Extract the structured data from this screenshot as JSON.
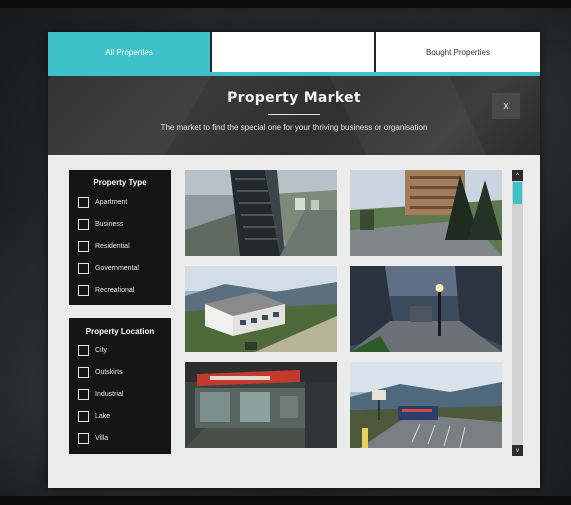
{
  "tabs": [
    {
      "label": "All Properties",
      "active": true
    },
    {
      "label": "",
      "active": false
    },
    {
      "label": "Bought Properties",
      "active": false
    }
  ],
  "header": {
    "title": "Property Market",
    "subtitle": "The market to find the special one for your thriving business or organisation",
    "close_label": "X"
  },
  "filters": {
    "property_type": {
      "title": "Property Type",
      "options": [
        "Apartment",
        "Business",
        "Residential",
        "Governmental",
        "Recreational"
      ]
    },
    "property_location": {
      "title": "Property Location",
      "options": [
        "City",
        "Outskirts",
        "Industrial",
        "Lake",
        "Villa"
      ]
    }
  },
  "listings": [
    {
      "image": "tall-building-aerial-view"
    },
    {
      "image": "building-with-trees-road"
    },
    {
      "image": "white-house-hillside"
    },
    {
      "image": "street-lamp-night-road"
    },
    {
      "image": "shop-interior"
    },
    {
      "image": "roadside-billboard-parking"
    }
  ],
  "scrollbar": {
    "up_label": "^",
    "down_label": "v"
  },
  "colors": {
    "accent": "#3fc1c9",
    "panel_bg": "#151515",
    "header_bg": "#2f2f2f",
    "window_bg": "#ececec"
  }
}
